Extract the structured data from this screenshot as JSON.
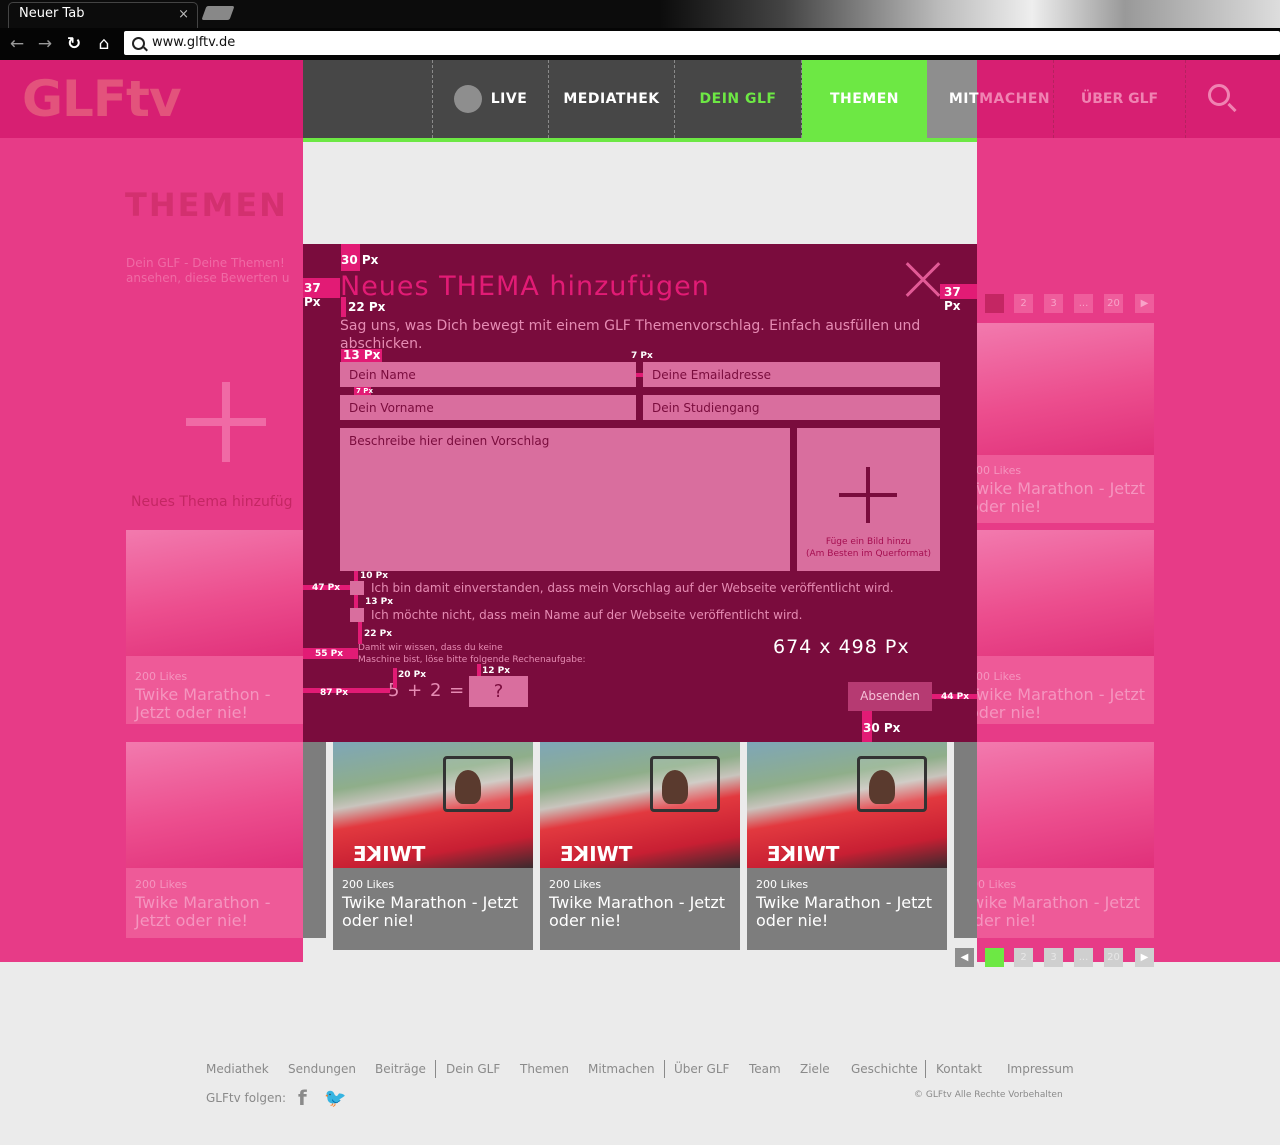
{
  "browser": {
    "tab_title": "Neuer Tab",
    "tab_close": "×",
    "url": "www.glftv.de"
  },
  "site": {
    "logo": "GLFtv",
    "nav": [
      {
        "label": "LIVE"
      },
      {
        "label": "MEDIATHEK"
      },
      {
        "label": "DEIN GLF"
      },
      {
        "label": "THEMEN"
      },
      {
        "label": "MITMACHEN"
      },
      {
        "label": "ÜBER GLF"
      }
    ]
  },
  "page": {
    "heading": "THEMEN",
    "intro_line1": "Dein GLF - Deine Themen!",
    "intro_line2": "ansehen, diese Bewerten u",
    "add_topic": "Neues Thema hinzufüg",
    "pagination": [
      "1",
      "2",
      "3",
      "...",
      "20"
    ]
  },
  "cards": {
    "likes": "200 Likes",
    "title": "Twike Marathon - Jetzt oder nie!",
    "brand": "TWIKE"
  },
  "modal": {
    "title": "Neues THEMA hinzufügen",
    "subtitle": "Sag uns, was Dich bewegt mit einem GLF Themenvorschlag. Einfach ausfüllen und abschicken.",
    "name_placeholder": "Dein Name",
    "email_placeholder": "Deine Emailadresse",
    "firstname_placeholder": "Dein Vorname",
    "study_placeholder": "Dein Studiengang",
    "description_placeholder": "Beschreibe hier deinen Vorschlag",
    "image_hint_line1": "Füge ein Bild hinzu",
    "image_hint_line2": "(Am Besten im Querformat)",
    "checkbox1": "Ich bin damit einverstanden, dass mein Vorschlag auf der Webseite veröffentlicht wird.",
    "checkbox2": "Ich möchte nicht, dass mein Name auf der Webseite veröffentlicht wird.",
    "captcha_text_line1": "Damit wir wissen, dass du keine",
    "captcha_text_line2": "Maschine bist, löse bitte folgende Rechenaufgabe:",
    "captcha_equation": "5 + 2 =",
    "captcha_answer": "?",
    "submit": "Absenden",
    "dimensions": "674 x 498 Px"
  },
  "measurements": {
    "m30_top": "30 Px",
    "m37_left": "37 Px",
    "m37_right": "37 Px",
    "m22": "22 Px",
    "m13": "13 Px",
    "m7_h": "7 Px",
    "m7_v": "7 Px",
    "m47": "47 Px",
    "m10": "10 Px",
    "m13_small": "13 Px",
    "m22_small": "22 Px",
    "m55": "55 Px",
    "m20": "20 Px",
    "m12": "12 Px",
    "m87": "87 Px",
    "m44": "44 Px",
    "m30_bottom": "30 Px"
  },
  "footer": {
    "links": [
      "Mediathek",
      "Sendungen",
      "Beiträge",
      "Dein GLF",
      "Themen",
      "Mitmachen",
      "Über GLF",
      "Team",
      "Ziele",
      "Geschichte",
      "Kontakt",
      "Impressum"
    ],
    "follow": "GLFtv folgen:",
    "copyright": "© GLFtv Alle Rechte Vorbehalten"
  },
  "colors": {
    "accent_green": "#6de844",
    "overlay_pink": "#e73b87",
    "modal_bg": "#7a0c3d",
    "measure_pink": "#e21b75"
  }
}
